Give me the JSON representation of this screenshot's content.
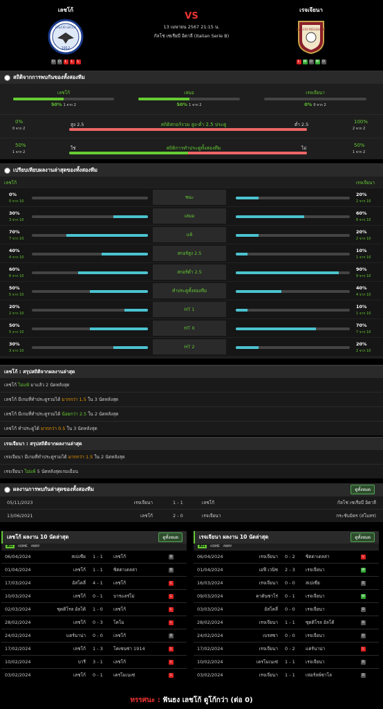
{
  "header": {
    "home": "เลชโก้",
    "away": "เรจเจียนา",
    "vs": "VS",
    "date": "13 เมษายน 2567 21:15 น.",
    "competition": "กัลโช่ เซเรียบี อิตาลี (Italian Serie B)",
    "home_form": [
      "D",
      "D",
      "L",
      "L",
      "L"
    ],
    "away_form": [
      "L",
      "W",
      "D",
      "W",
      "D"
    ],
    "home_crest_text": "CALCIO LECCO",
    "home_crest_year": "1912",
    "away_crest_text": "CALCIO REGGIANA"
  },
  "h2h": {
    "title": "สถิติจากการพบกันของทั้งสองทีม",
    "home": {
      "label": "เลชโก้",
      "pct": "50%",
      "sub": "1 จาก 2"
    },
    "draw": {
      "label": "เสมอ",
      "pct": "50%",
      "sub": "1 จาก 2"
    },
    "away": {
      "label": "เรจเจียนา",
      "pct": "0%",
      "sub": "0 จาก 2"
    },
    "ou": {
      "lp": "0%",
      "ls": "0 จาก 2",
      "left": "สูง 2.5",
      "mid": "สถิติสกอร์รวม สูง-ต่ำ 2.5 ประตู",
      "right": "ต่ำ 2.5",
      "rp": "100%",
      "rs": "2 จาก 2"
    },
    "btts": {
      "lp": "50%",
      "ls": "1 จาก 2",
      "left": "ใช่",
      "mid": "สถิติการทำประตูทั้งสองทีม",
      "right": "ไม่",
      "rp": "50%",
      "rs": "1 จาก 2"
    }
  },
  "compare": {
    "title": "เปรียบเทียบผลงานล่าสุดของทั้งสองทีม",
    "home": "เลชโก้",
    "away": "เรจเจียนา",
    "rows": [
      {
        "label": "ชนะ",
        "lv": "0%",
        "ls": "0 จาก 10",
        "lf": 0,
        "rv": "20%",
        "rs": "2 จาก 10",
        "rf": 0.2
      },
      {
        "label": "เสมอ",
        "lv": "30%",
        "ls": "3 จาก 10",
        "lf": 0.3,
        "rv": "60%",
        "rs": "6 จาก 10",
        "rf": 0.6
      },
      {
        "label": "แพ้",
        "lv": "70%",
        "ls": "7 จาก 10",
        "lf": 0.7,
        "rv": "20%",
        "rs": "2 จาก 10",
        "rf": 0.2
      },
      {
        "label": "สกอร์สูง 2.5",
        "lv": "40%",
        "ls": "4 จาก 10",
        "lf": 0.4,
        "rv": "10%",
        "rs": "1 จาก 10",
        "rf": 0.1
      },
      {
        "label": "สกอร์ต่ำ 2.5",
        "lv": "60%",
        "ls": "6 จาก 10",
        "lf": 0.6,
        "rv": "90%",
        "rs": "9 จาก 10",
        "rf": 0.9
      },
      {
        "label": "ทำประตูทั้งสองทีม",
        "lv": "50%",
        "ls": "5 จาก 10",
        "lf": 0.5,
        "rv": "40%",
        "rs": "4 จาก 10",
        "rf": 0.4
      },
      {
        "label": "HT 1",
        "lv": "20%",
        "ls": "2 จาก 10",
        "lf": 0.2,
        "rv": "10%",
        "rs": "1 จาก 10",
        "rf": 0.1
      },
      {
        "label": "HT X",
        "lv": "50%",
        "ls": "5 จาก 10",
        "lf": 0.5,
        "rv": "70%",
        "rs": "7 จาก 10",
        "rf": 0.7
      },
      {
        "label": "HT 2",
        "lv": "30%",
        "ls": "3 จาก 10",
        "lf": 0.3,
        "rv": "20%",
        "rs": "2 จาก 10",
        "rf": 0.2
      }
    ]
  },
  "summary_home": {
    "title": "เลชโก้ : สรุปสถิติจากผลงานล่าสุด",
    "rows": [
      {
        "a": "เลชโก้ ",
        "h": "ไม่แพ้",
        "b": " มาแล้ว 2 นัดหลังสุด",
        "c": "g"
      },
      {
        "a": "เลชโก้ มีเกมที่ทำประตูรวมได้ ",
        "h": "มากกว่า 1.5",
        "b": " ใน 3 นัดหลังสุด",
        "c": "o"
      },
      {
        "a": "เลชโก้ มีเกมที่ทำประตูรวมได้ ",
        "h": "น้อยกว่า 2.5",
        "b": " ใน 2 นัดหลังสุด",
        "c": "g"
      },
      {
        "a": "เลชโก้ ทำประตูได้ ",
        "h": "มากกว่า 0.5",
        "b": " ใน 3 นัดหลังสุด",
        "c": "o"
      }
    ]
  },
  "summary_away": {
    "title": "เรจเจียนา : สรุปสถิติจากผลงานล่าสุด",
    "rows": [
      {
        "a": "เรจเจียนา มีเกมที่ทำประตูรวมได้ ",
        "h": "มากกว่า 1.5",
        "b": " ใน 2 นัดหลังสุด",
        "c": "o"
      },
      {
        "a": "เรจเจียนา ",
        "h": "ไม่แพ้",
        "b": " 5 นัดหลังสุดเกมเยือน",
        "c": "g"
      }
    ]
  },
  "history": {
    "title": "ผลงานการพบกันล่าสุดของทั้งสองทีม",
    "btn": "ดูทั้งหมด",
    "rows": [
      {
        "date": "05/11/2023",
        "home": "เรจเจียนา",
        "score": "1 - 1",
        "away": "เลชโก้",
        "comp": "กัลโช่ เซเรียบี อิตาลี"
      },
      {
        "date": "13/06/2021",
        "home": "เลชโก้",
        "score": "2 - 0",
        "away": "เรจเจียนา",
        "comp": "กระชับมิตร (สโมสร)"
      }
    ]
  },
  "last10_home": {
    "title": "เลชโก้ ผลงาน 10 นัดล่าสุด",
    "btn": "ดูทั้งหมด",
    "tabs": [
      "ALL",
      "HOME",
      "AWAY"
    ],
    "rows": [
      {
        "d": "06/04/2024",
        "h": "สเปเซีย",
        "s": "1 - 1",
        "a": "เลชโก้",
        "r": "D"
      },
      {
        "d": "01/04/2024",
        "h": "เลชโก้",
        "s": "1 - 1",
        "a": "ซิตตาเดลล่า",
        "r": "D"
      },
      {
        "d": "17/03/2024",
        "h": "อัสโคลี่",
        "s": "4 - 1",
        "a": "เลชโก้",
        "r": "L"
      },
      {
        "d": "10/03/2024",
        "h": "เลชโก้",
        "s": "0 - 1",
        "a": "บารแลร่โม่",
        "r": "L"
      },
      {
        "d": "02/03/2024",
        "h": "ซุดติโรล อัลโต้",
        "s": "1 - 0",
        "a": "เลชโก้",
        "r": "L"
      },
      {
        "d": "28/02/2024",
        "h": "เลชโก้",
        "s": "0 - 3",
        "a": "โคโม",
        "r": "L"
      },
      {
        "d": "24/02/2024",
        "h": "แตร์นาน่า",
        "s": "0 - 0",
        "a": "เลชโก้",
        "r": "D"
      },
      {
        "d": "17/02/2024",
        "h": "เลชโก้",
        "s": "1 - 3",
        "a": "โคเซนซ่า 1914",
        "r": "L"
      },
      {
        "d": "10/02/2024",
        "h": "บารี",
        "s": "3 - 1",
        "a": "เลชโก้",
        "r": "L"
      },
      {
        "d": "03/02/2024",
        "h": "เลชโก้",
        "s": "0 - 1",
        "a": "เครโมเนเซ่",
        "r": "L"
      }
    ]
  },
  "last10_away": {
    "title": "เรจเจียนา ผลงาน 10 นัดล่าสุด",
    "btn": "ดูทั้งหมด",
    "tabs": [
      "ALL",
      "HOME",
      "AWAY"
    ],
    "rows": [
      {
        "d": "06/04/2024",
        "h": "เรจเจียนา",
        "s": "0 - 2",
        "a": "ซิตตาเดลล่า",
        "r": "L"
      },
      {
        "d": "01/04/2024",
        "h": "เอฟี เวนิซ",
        "s": "2 - 3",
        "a": "เรจเจียนา",
        "r": "W"
      },
      {
        "d": "16/03/2024",
        "h": "เรจเจียนา",
        "s": "0 - 0",
        "a": "สเปเซีย",
        "r": "D"
      },
      {
        "d": "09/03/2024",
        "h": "คาตันซาโร่",
        "s": "0 - 1",
        "a": "เรจเจียนา",
        "r": "W"
      },
      {
        "d": "03/03/2024",
        "h": "อัสโคลี่",
        "s": "0 - 0",
        "a": "เรจเจียนา",
        "r": "D"
      },
      {
        "d": "28/02/2024",
        "h": "เรจเจียนา",
        "s": "1 - 1",
        "a": "ซุดติโรล อัลโต้",
        "r": "D"
      },
      {
        "d": "24/02/2024",
        "h": "เบรสซา",
        "s": "0 - 0",
        "a": "เรจเจียนา",
        "r": "D"
      },
      {
        "d": "17/02/2024",
        "h": "เรจเจียนา",
        "s": "0 - 2",
        "a": "แตร์นาน่า",
        "r": "L"
      },
      {
        "d": "10/02/2024",
        "h": "เครโมเนเซ่",
        "s": "1 - 1",
        "a": "เรจเจียนา",
        "r": "D"
      },
      {
        "d": "03/02/2024",
        "h": "เรจเจียนา",
        "s": "1 - 1",
        "a": "เฟอร์ลพ์ซาโล",
        "r": "D"
      }
    ]
  },
  "tip": {
    "label": "ทรรศนะ :",
    "text": "ฟันธง เลชโก้ ดูโก้กว่า (ต่อ 0)"
  },
  "colors": {
    "green": "#6c3",
    "red": "#e33",
    "blue": "#4bc3d0",
    "orange": "#e90"
  }
}
